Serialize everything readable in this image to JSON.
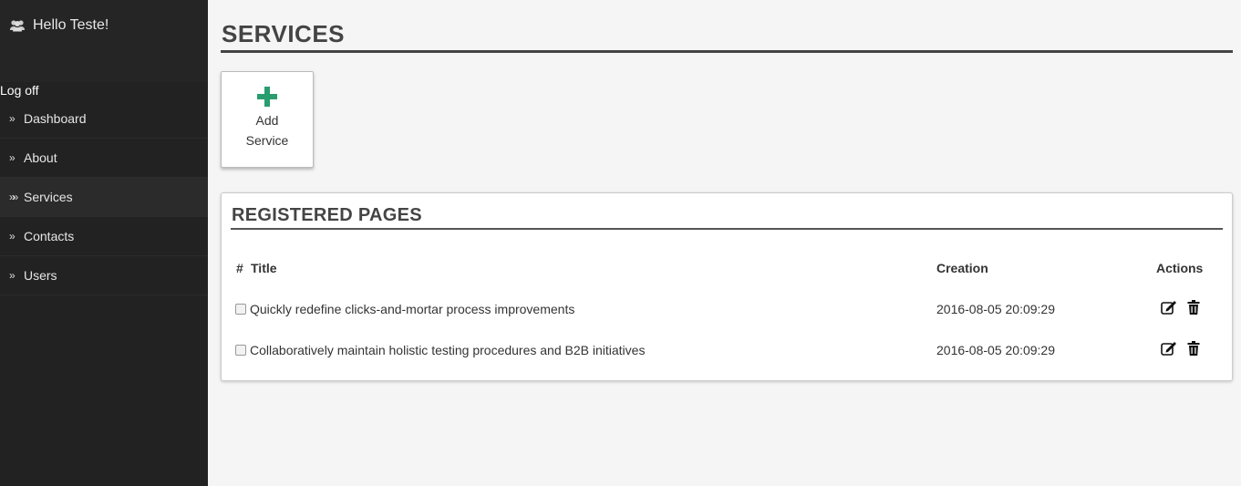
{
  "sidebar": {
    "greeting": "Hello Teste!",
    "greeting_icon": "users-icon",
    "logoff_label": "Log off",
    "items": [
      {
        "label": "Dashboard",
        "icon": "double-chevron-right-icon"
      },
      {
        "label": "About",
        "icon": "double-chevron-right-icon"
      },
      {
        "label": "Services",
        "icon": "triple-chevron-right-icon",
        "active": true
      },
      {
        "label": "Contacts",
        "icon": "double-chevron-right-icon"
      },
      {
        "label": "Users",
        "icon": "double-chevron-right-icon"
      }
    ]
  },
  "main": {
    "title": "SERVICES",
    "add_button": {
      "line1": "Add",
      "line2": "Service",
      "icon": "plus-icon",
      "icon_color": "#2a9d6f"
    },
    "panel": {
      "title": "REGISTERED PAGES",
      "columns": {
        "number": "#",
        "title": "Title",
        "creation": "Creation",
        "actions": "Actions"
      },
      "rows": [
        {
          "title": "Quickly redefine clicks-and-mortar process improvements",
          "creation": "2016-08-05 20:09:29"
        },
        {
          "title": "Collaboratively maintain holistic testing procedures and B2B initiatives",
          "creation": "2016-08-05 20:09:29"
        }
      ]
    }
  },
  "colors": {
    "sidebar_bg": "#222222",
    "page_bg": "#f5f5f5",
    "accent_green": "#2a9d6f"
  }
}
